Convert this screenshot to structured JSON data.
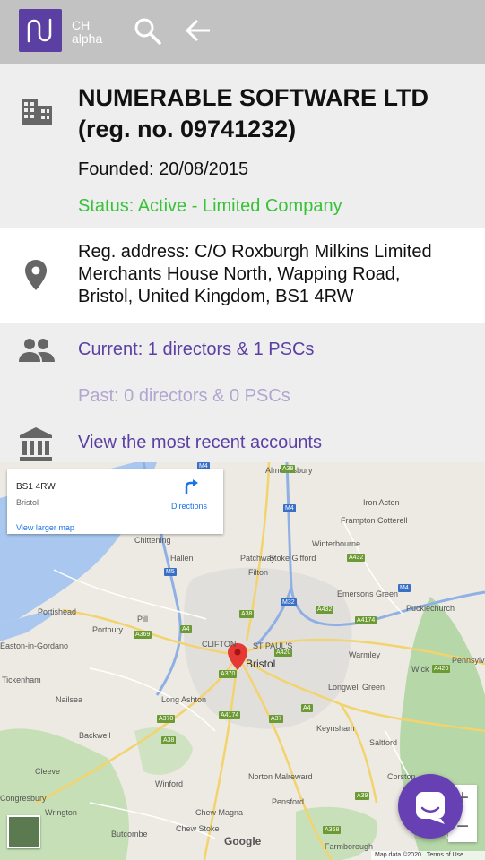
{
  "header": {
    "brand_line1": "CH",
    "brand_line2": "alpha",
    "logo_icon": "numerable-logo-icon",
    "search_icon": "search-icon",
    "back_icon": "arrow-back-icon"
  },
  "company": {
    "icon": "building-icon",
    "name_line1": "NUMERABLE SOFTWARE LTD",
    "name_line2": "(reg. no. 09741232)",
    "founded": "Founded: 20/08/2015",
    "status": "Status: Active - Limited Company",
    "status_color": "#38c238"
  },
  "address": {
    "icon": "location-pin-icon",
    "line1": "Reg. address: C/O Roxburgh Milkins Limited",
    "line2": "Merchants House North, Wapping Road,",
    "line3": "Bristol, United Kingdom, BS1 4RW"
  },
  "officers": {
    "icon": "people-icon",
    "current": "Current: 1 directors & 1 PSCs",
    "past": "Past: 0 directors & 0 PSCs"
  },
  "accounts": {
    "icon": "bank-icon",
    "link": "View the most recent accounts"
  },
  "accent_color": "#5b3fa3",
  "map": {
    "card_title": "BS1 4RW",
    "card_subtitle": "Bristol",
    "card_link": "View larger map",
    "directions": "Directions",
    "places": [
      "Almondsbury",
      "Iron Acton",
      "Frampton Cotterell",
      "Patchway",
      "Winterbourne",
      "Chittening",
      "Hallen",
      "Stoke Gifford",
      "Filton",
      "Emersons Green",
      "Pucklechurch",
      "Portishead",
      "Portbury",
      "Pill",
      "CLIFTON",
      "ST PAUL'S",
      "Bristol",
      "Warmley",
      "Wick",
      "Pennsylvania",
      "Easton-in-Gordano",
      "Tickenham",
      "Nailsea",
      "Long Ashton",
      "Longwell Green",
      "Keynsham",
      "Saltford",
      "Backwell",
      "Cleeve",
      "Winford",
      "Norton Malreward",
      "Pensford",
      "Corston",
      "Wrington",
      "Chew Magna",
      "Chew Stoke",
      "Butcombe",
      "Farmborough",
      "Congresbury"
    ],
    "roads": [
      "M4",
      "A38",
      "M5",
      "M32",
      "A432",
      "A4174",
      "A4",
      "A369",
      "A370",
      "A420",
      "A37",
      "A39",
      "A368"
    ],
    "zoom_in": "+",
    "zoom_out": "−",
    "google": "Google",
    "map_data": "Map data ©2020",
    "terms": "Terms of Use",
    "chat_icon": "chat-bubble-icon",
    "layer_icon": "satellite-layer-icon"
  }
}
